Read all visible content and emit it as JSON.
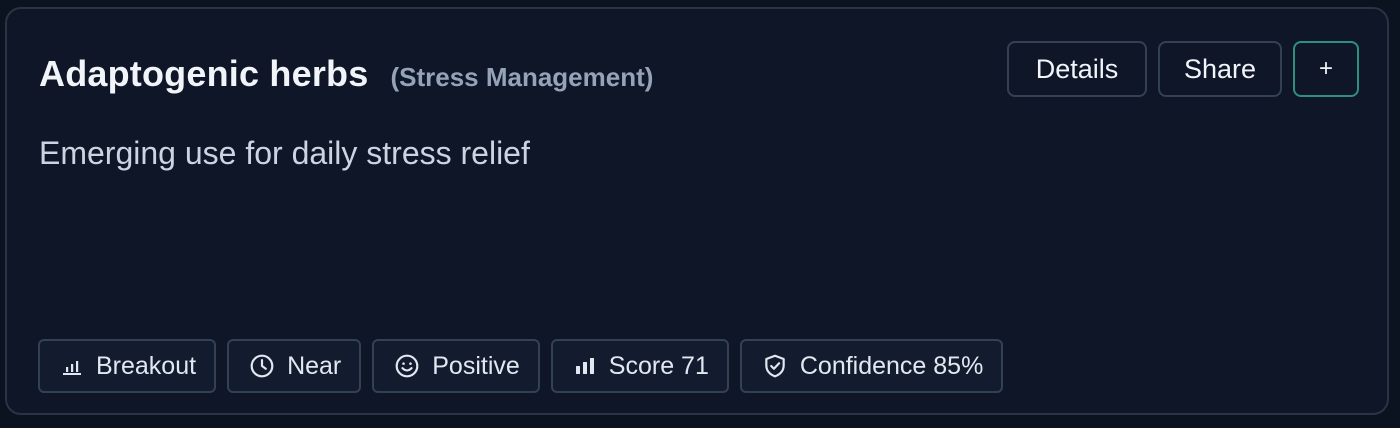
{
  "card": {
    "title": "Adaptogenic herbs",
    "category": "(Stress Management)",
    "description": "Emerging use for daily stress relief"
  },
  "actions": {
    "details_label": "Details",
    "share_label": "Share",
    "add_label": "+"
  },
  "badges": [
    {
      "icon": "bar-chart-icon",
      "label": "Breakout"
    },
    {
      "icon": "clock-icon",
      "label": "Near"
    },
    {
      "icon": "smile-icon",
      "label": "Positive"
    },
    {
      "icon": "signal-bars-icon",
      "label": "Score 71"
    },
    {
      "icon": "shield-check-icon",
      "label": "Confidence 85%"
    }
  ],
  "colors": {
    "background": "#0b1220",
    "card": "#0e1628",
    "border": "#2a3444",
    "accent": "#2f8f7c",
    "title": "#f1f5f9",
    "muted": "#94a3b8"
  }
}
